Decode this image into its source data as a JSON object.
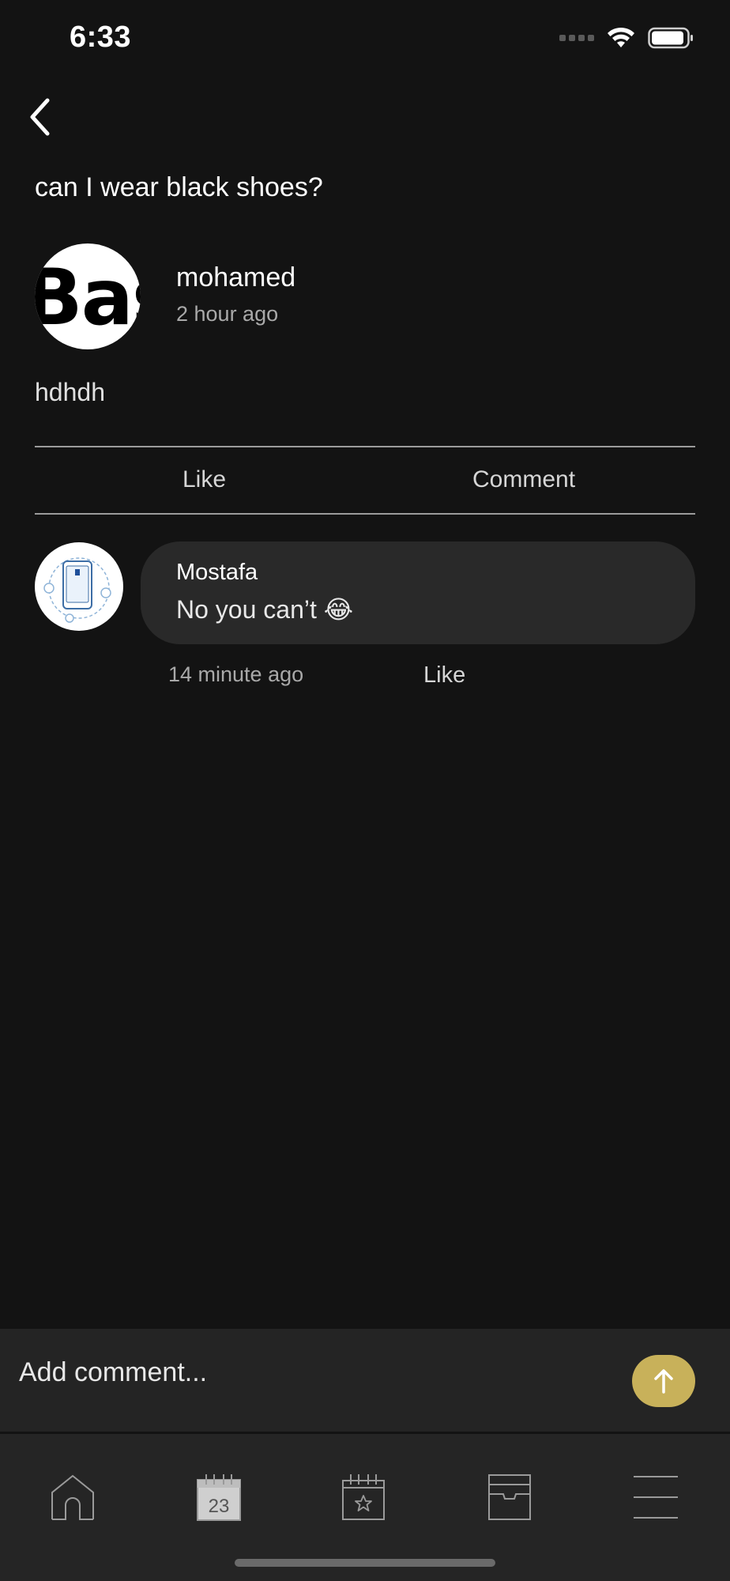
{
  "status_bar": {
    "time": "6:33"
  },
  "post": {
    "title": "can I wear black shoes?",
    "author": "mohamed",
    "time": "2 hour ago",
    "body": "hdhdh",
    "avatar_text": "Bas"
  },
  "actions": {
    "like_label": "Like",
    "comment_label": "Comment"
  },
  "comments": [
    {
      "author": "Mostafa",
      "text": "No you can’t 😂",
      "time": "14 minute ago",
      "like_label": "Like"
    }
  ],
  "composer": {
    "placeholder": "Add comment..."
  },
  "tabbar": {
    "items": [
      {
        "name": "home",
        "icon": "home-icon"
      },
      {
        "name": "calendar",
        "icon": "calendar-icon",
        "day": "23"
      },
      {
        "name": "events",
        "icon": "calendar-star-icon"
      },
      {
        "name": "inbox",
        "icon": "inbox-icon"
      },
      {
        "name": "menu",
        "icon": "menu-icon"
      }
    ]
  },
  "colors": {
    "background": "#131313",
    "accent": "#c8b15a",
    "bubble": "#292929"
  }
}
